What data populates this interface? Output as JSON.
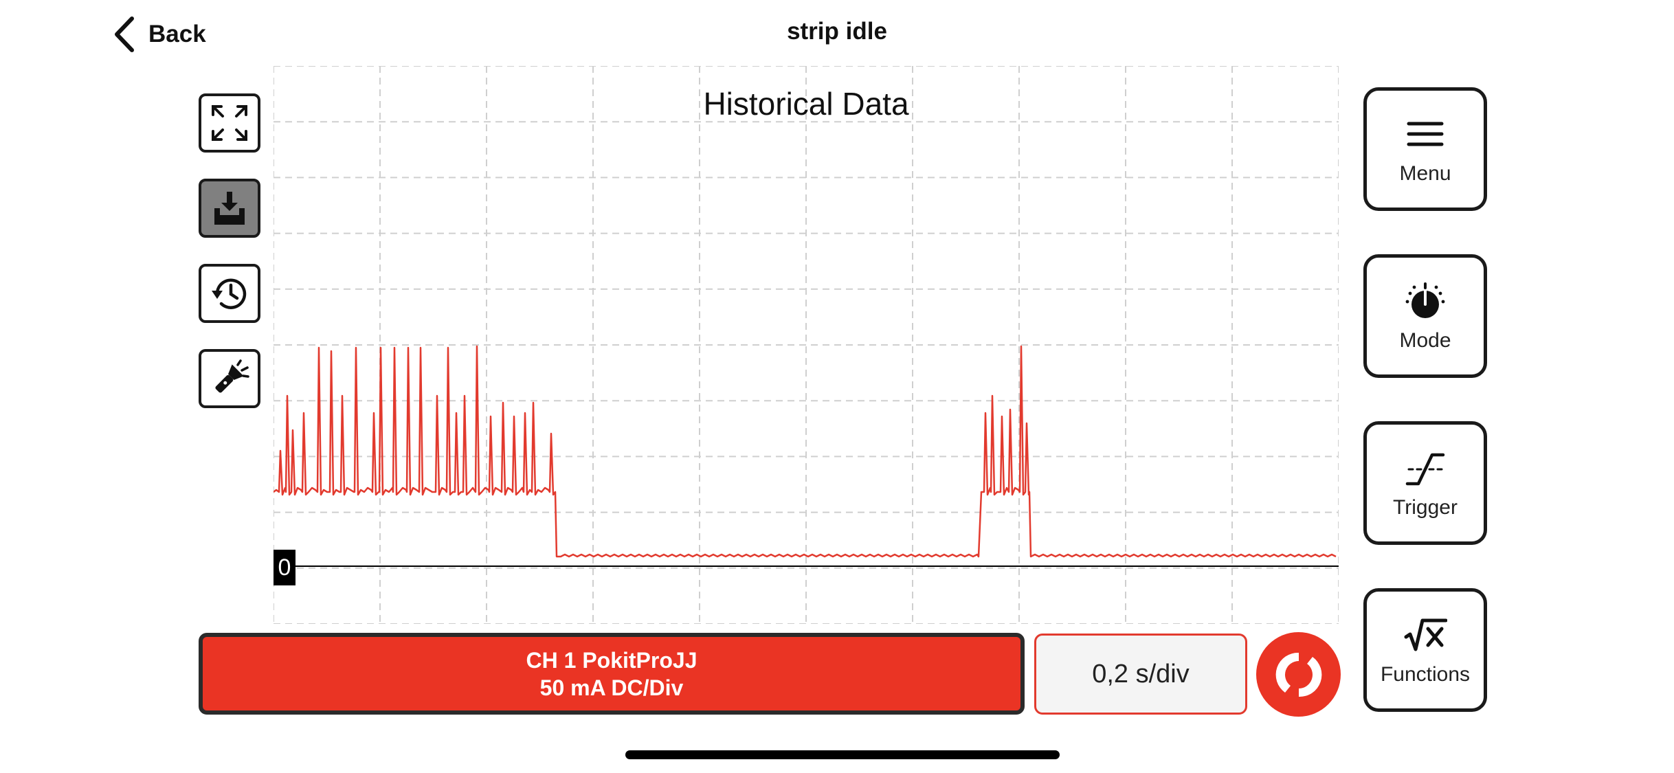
{
  "nav": {
    "back_label": "Back",
    "title": "strip idle"
  },
  "toolbar": {
    "left_icons": [
      "fullscreen-icon",
      "download-icon",
      "history-icon",
      "flashlight-icon"
    ],
    "active_index": 1
  },
  "plot": {
    "title": "Historical Data",
    "zero_label": "0",
    "trace_color": "#e23a2e",
    "grid": true
  },
  "footer": {
    "channel_line1": "CH 1 PokitProJJ",
    "channel_line2": "50 mA DC/Div",
    "timebase": "0,2 s/div",
    "run_icon": "run-refresh-icon"
  },
  "side_buttons": [
    {
      "label": "Menu",
      "icon": "menu-icon"
    },
    {
      "label": "Mode",
      "icon": "mode-dial-icon"
    },
    {
      "label": "Trigger",
      "icon": "trigger-icon"
    },
    {
      "label": "Functions",
      "icon": "sqrt-function-icon"
    }
  ],
  "colors": {
    "accent": "#ea3424",
    "background": "#ffffff"
  }
}
